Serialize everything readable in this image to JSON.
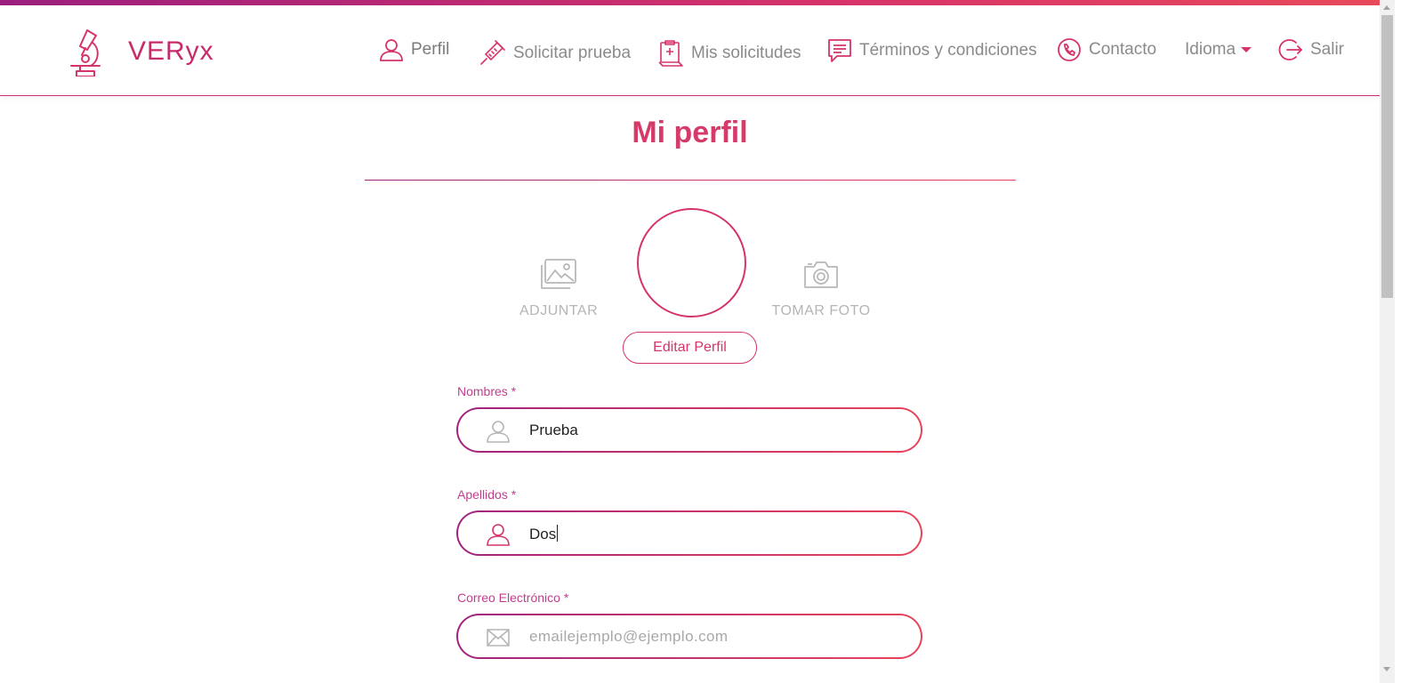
{
  "brand": {
    "name": "VERyx",
    "logo_icon": "microscope-icon",
    "accent_color": "#d6336c",
    "gradient_start": "#9b1f7e",
    "gradient_end": "#e84a5a"
  },
  "nav": {
    "items": [
      {
        "label": "Perfil",
        "icon": "user-icon"
      },
      {
        "label": "Solicitar prueba",
        "icon": "syringe-icon"
      },
      {
        "label": "Mis solicitudes",
        "icon": "medical-report-icon"
      },
      {
        "label": "Términos y condiciones",
        "icon": "message-icon"
      },
      {
        "label": "Contacto",
        "icon": "phone-icon"
      },
      {
        "label": "Idioma",
        "icon": "caret-down-icon"
      },
      {
        "label": "Salir",
        "icon": "logout-icon"
      }
    ]
  },
  "page": {
    "title": "Mi perfil"
  },
  "photo": {
    "attach_label": "ADJUNTAR",
    "attach_icon": "image-icon",
    "take_label": "TOMAR FOTO",
    "take_icon": "camera-icon",
    "edit_button": "Editar Perfil"
  },
  "form": {
    "first_name": {
      "label": "Nombres *",
      "value": "Prueba",
      "icon": "user-icon"
    },
    "last_name": {
      "label": "Apellidos *",
      "value": "Dos",
      "icon": "user-icon"
    },
    "email": {
      "label": "Correo Electrónico *",
      "value": "",
      "placeholder": "emailejemplo@ejemplo.com",
      "icon": "envelope-icon"
    }
  }
}
